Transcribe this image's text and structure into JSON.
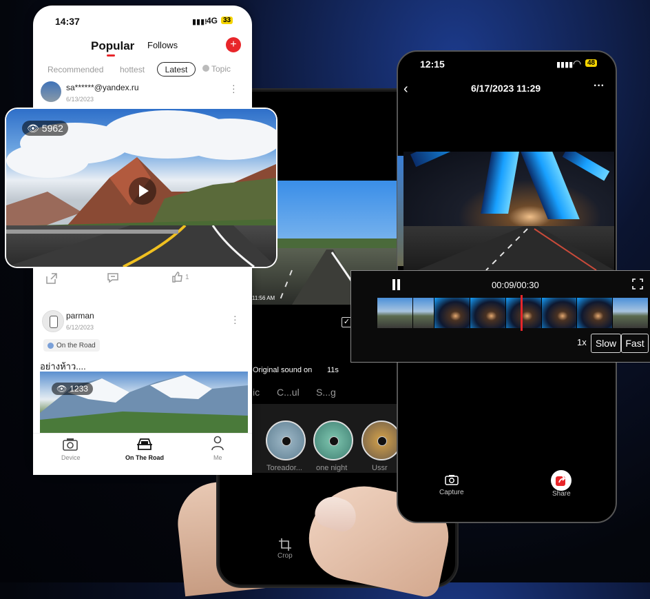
{
  "left_phone": {
    "status_time": "14:37",
    "network": "4G",
    "battery": "33",
    "header_tabs": [
      "Popular",
      "Follows"
    ],
    "sub_tabs": [
      "Recommended",
      "hottest",
      "Latest",
      "Topic"
    ],
    "post1": {
      "username": "sa******@yandex.ru",
      "date": "6/13/2023",
      "views": "5962",
      "likes": "1"
    },
    "post2": {
      "username": "parman",
      "date": "6/12/2023",
      "tag": "On the Road",
      "caption": "อย่างห้าว....",
      "views": "1233"
    },
    "bottom_nav": [
      "Device",
      "On The Road",
      "Me"
    ]
  },
  "middle_phone": {
    "video_overlay": "11:56 AM",
    "sound_label": "Original sound on",
    "duration": "11s",
    "music_tabs": [
      "ic",
      "C...ul",
      "S...g"
    ],
    "tracks": [
      "Toreador...",
      "one night",
      "Ussr"
    ],
    "crop_label": "Crop"
  },
  "right_phone": {
    "status_time": "12:15",
    "battery": "48",
    "title": "6/17/2023 11:29",
    "playback_time": "00:09/00:30",
    "speeds": [
      "1x",
      "Slow",
      "Fast"
    ],
    "progress_fraction": 0.3,
    "actions": [
      "Capture",
      "Share"
    ]
  },
  "colors": {
    "accent_red": "#e8262a",
    "dark_bg": "#000000",
    "battery_yellow": "#f5d400"
  }
}
